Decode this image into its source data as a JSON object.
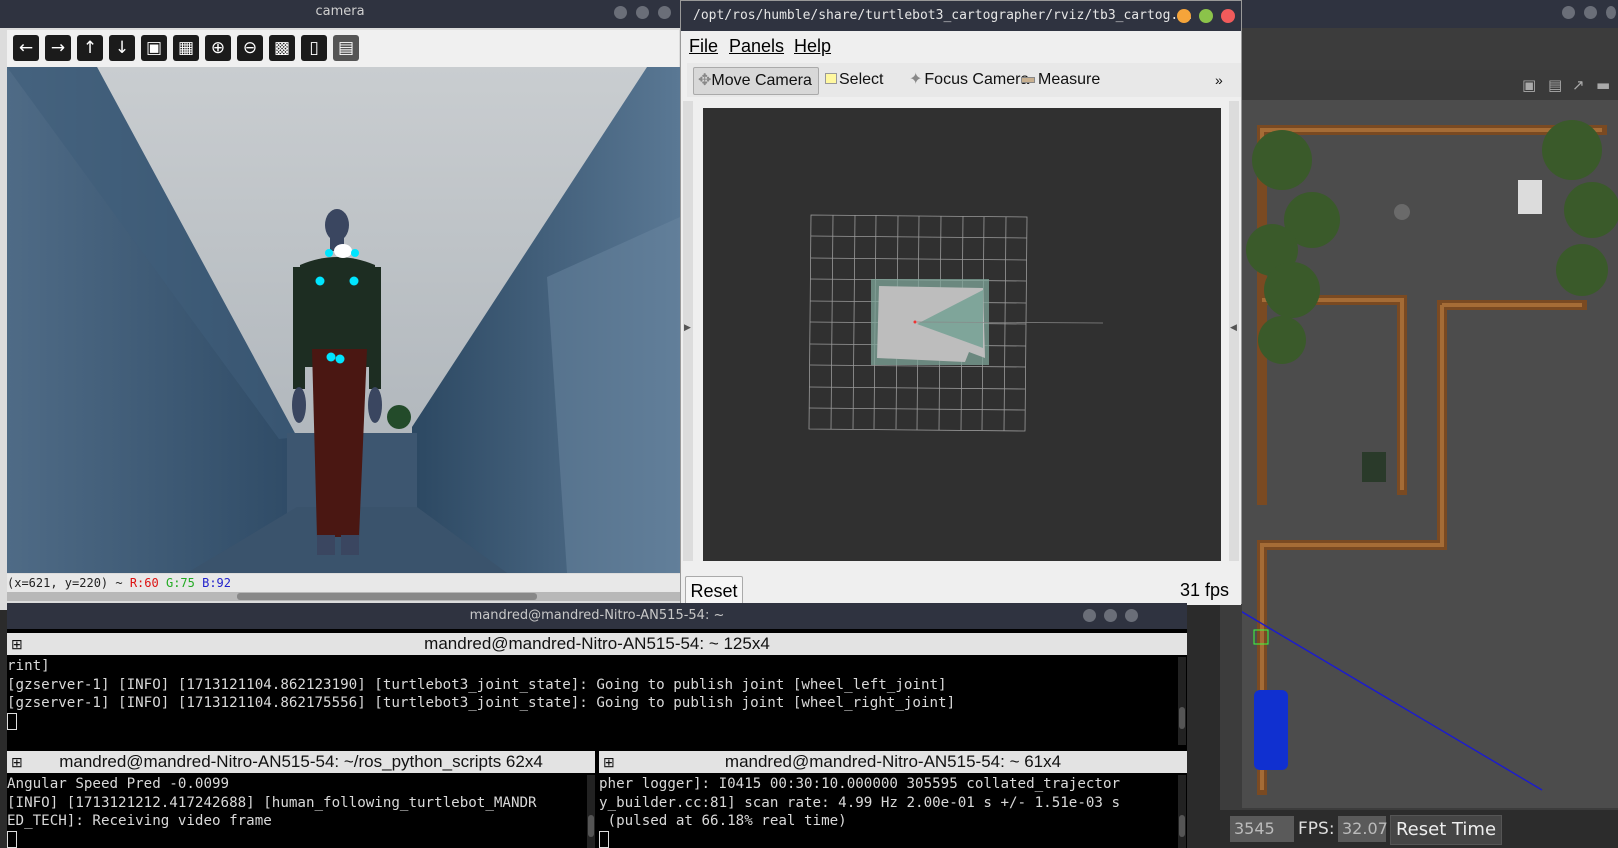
{
  "camera_window": {
    "title": "camera",
    "toolbar_icons": [
      "arrow-left-icon",
      "arrow-right-icon",
      "arrow-up-icon",
      "arrow-down-icon",
      "image-icon",
      "image-edit-icon",
      "zoom-in-icon",
      "zoom-out-icon",
      "save-icon",
      "clipboard-icon",
      "paint-icon"
    ],
    "status": {
      "coords": "(x=621, y=220) ~ ",
      "r": "R:60",
      "g": "G:75",
      "b": "B:92"
    }
  },
  "rviz": {
    "title": "/opt/ros/humble/share/turtlebot3_cartographer/rviz/tb3_cartog...",
    "menu": [
      "File",
      "Panels",
      "Help"
    ],
    "tools": [
      {
        "label": "Move Camera",
        "icon": "move-camera-icon",
        "active": true
      },
      {
        "label": "Select",
        "icon": "select-icon",
        "active": false
      },
      {
        "label": "Focus Camera",
        "icon": "focus-camera-icon",
        "active": false
      },
      {
        "label": "Measure",
        "icon": "measure-icon",
        "active": false
      }
    ],
    "overflow": "»",
    "reset_label": "Reset",
    "fps": "31 fps"
  },
  "terminal": {
    "window_title": "mandred@mandred-Nitro-AN515-54: ~",
    "top_pane": {
      "title": "mandred@mandred-Nitro-AN515-54: ~ 125x4",
      "lines": [
        "rint]",
        "[gzserver-1] [INFO] [1713121104.862123190] [turtlebot3_joint_state]: Going to publish joint [wheel_left_joint]",
        "[gzserver-1] [INFO] [1713121104.862175556] [turtlebot3_joint_state]: Going to publish joint [wheel_right_joint]"
      ]
    },
    "left_pane": {
      "title": "mandred@mandred-Nitro-AN515-54: ~/ros_python_scripts 62x4",
      "lines": [
        "Angular Speed Pred -0.0099",
        "[INFO] [1713121212.417242688] [human_following_turtlebot_MANDR",
        "ED_TECH]: Receiving video frame"
      ]
    },
    "right_pane": {
      "title": "mandred@mandred-Nitro-AN515-54: ~ 61x4",
      "lines": [
        "pher logger]: I0415 00:30:10.000000 305595 collated_trajector",
        "y_builder.cc:81] scan rate: 4.99 Hz 2.00e-01 s +/- 1.51e-03 s",
        " (pulsed at 66.18% real time)"
      ]
    }
  },
  "gazebo": {
    "sim_time_partial": "3545",
    "fps_label": "FPS:",
    "fps_value": "32.07",
    "reset_time_label": "Reset Time",
    "toolbar_icons": [
      "camera-icon",
      "record-icon",
      "plot-icon",
      "video-icon"
    ]
  },
  "colors": {
    "titlebar": "#2f3340",
    "rviz_close": "#f15b5b",
    "rviz_min": "#f5a43a",
    "rviz_max": "#8bc34a",
    "cyan_keypoint": "#00e5ff"
  }
}
